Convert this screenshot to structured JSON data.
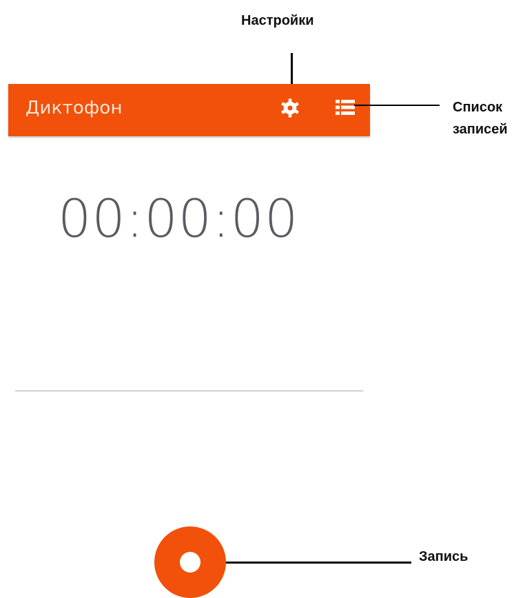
{
  "appbar": {
    "title": "Диктофон",
    "color": "#f1510a",
    "settings_icon": "gear-icon",
    "list_icon": "list-icon"
  },
  "timer": {
    "value": "00:00:00"
  },
  "record": {
    "icon": "record-dot-icon",
    "color": "#f1510a"
  },
  "annotations": {
    "settings": "Настройки",
    "list_line1": "Список",
    "list_line2": "записей",
    "record": "Запись"
  }
}
